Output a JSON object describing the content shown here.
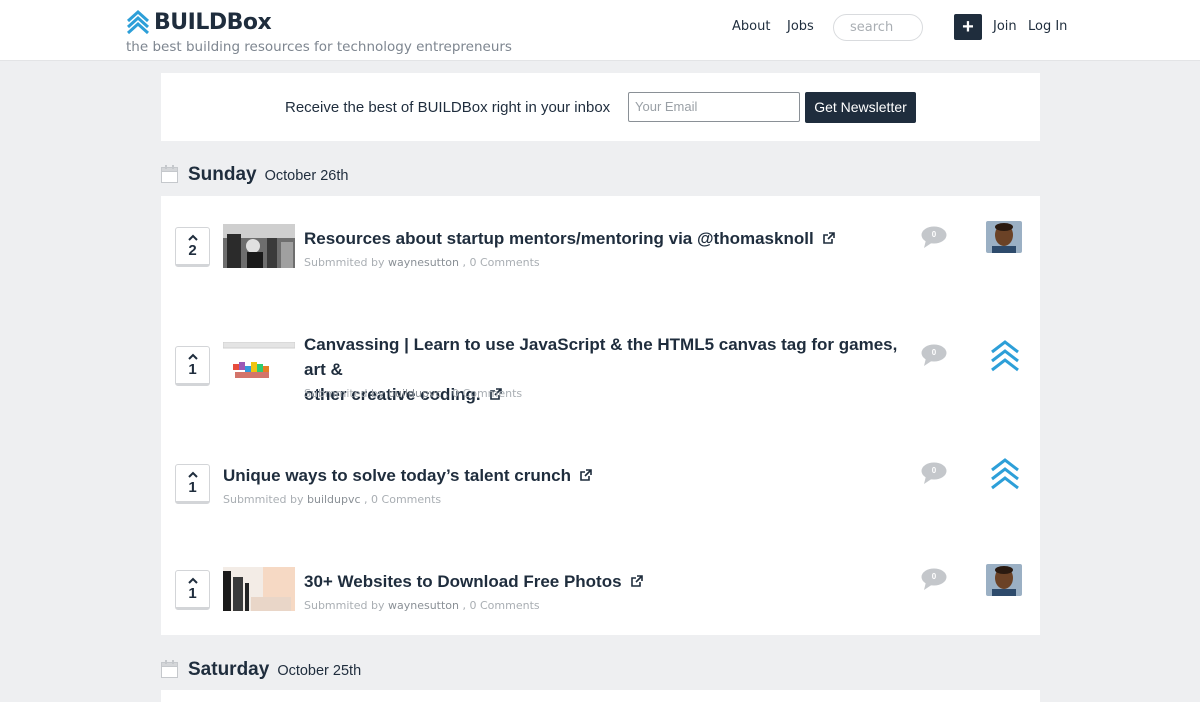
{
  "header": {
    "brand": "BUILDBox",
    "tagline": "the best building resources for technology entrepreneurs",
    "nav": {
      "about": "About",
      "jobs": "Jobs",
      "join": "Join",
      "login": "Log In"
    },
    "search_placeholder": "search",
    "add_label": "+"
  },
  "newsletter": {
    "text": "Receive the best of BUILDBox right in your inbox",
    "email_placeholder": "Your Email",
    "button": "Get Newsletter"
  },
  "days": [
    {
      "name": "Sunday",
      "date": "October 26th",
      "posts": [
        {
          "votes": "2",
          "title": "Resources about startup mentors/mentoring via @thomasknoll",
          "submitted_prefix": "Submmited by",
          "user": "waynesutton",
          "comments_text": ", 0 Comments",
          "comment_count": "0",
          "author_avatar": "person-photo"
        },
        {
          "votes": "1",
          "title_line1": "Canvassing | Learn to use JavaScript & the HTML5 canvas tag for games, art &",
          "title_line2": "other creative coding.",
          "submitted_prefix": "Submmited by",
          "user": "buildupvc",
          "comments_text": ", 0 Comments",
          "comment_count": "0",
          "author_avatar": "buildbox-chevrons"
        },
        {
          "votes": "1",
          "title": "Unique ways to solve today’s talent crunch",
          "submitted_prefix": "Submmited by",
          "user": "buildupvc",
          "comments_text": ", 0 Comments",
          "comment_count": "0",
          "author_avatar": "buildbox-chevrons"
        },
        {
          "votes": "1",
          "title": "30+ Websites to Download Free Photos",
          "submitted_prefix": "Submmited by",
          "user": "waynesutton",
          "comments_text": ", 0 Comments",
          "comment_count": "0",
          "author_avatar": "person-photo"
        }
      ]
    },
    {
      "name": "Saturday",
      "date": "October 25th"
    }
  ],
  "colors": {
    "brand_blue": "#2d9fd8",
    "navy": "#1f2d3d",
    "page_bg": "#eeeff1",
    "muted": "#a9aeb3"
  }
}
